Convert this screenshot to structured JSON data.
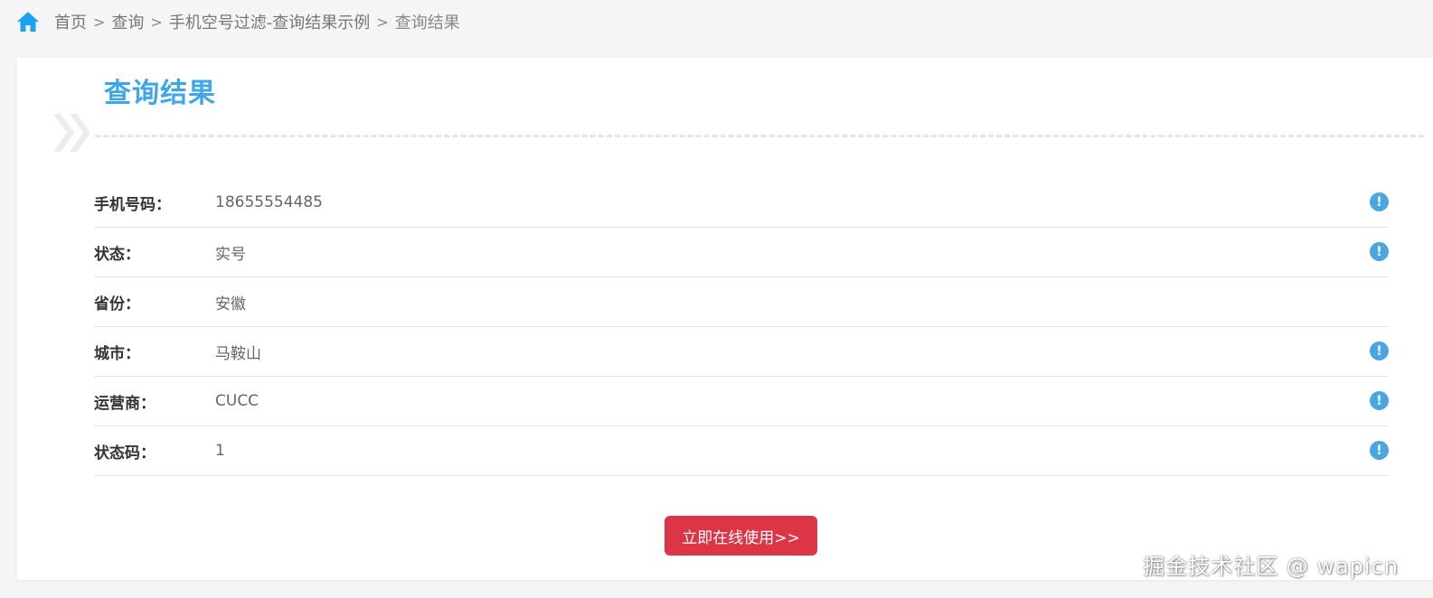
{
  "breadcrumb": {
    "items": [
      "首页",
      "查询",
      "手机空号过滤-查询结果示例",
      "查询结果"
    ],
    "separator": ">"
  },
  "result": {
    "title": "查询结果",
    "rows": [
      {
        "label": "手机号码：",
        "value": "18655554485",
        "has_info_icon": true
      },
      {
        "label": "状态：",
        "value": "实号",
        "has_info_icon": true
      },
      {
        "label": "省份：",
        "value": "安徽",
        "has_info_icon": false
      },
      {
        "label": "城市：",
        "value": "马鞍山",
        "has_info_icon": true
      },
      {
        "label": "运营商：",
        "value": "CUCC",
        "has_info_icon": true
      },
      {
        "label": "状态码：",
        "value": "1",
        "has_info_icon": true
      }
    ],
    "info_icon_glyph": "!"
  },
  "action": {
    "use_label": "立即在线使用>>"
  },
  "watermark": {
    "text": "掘金技术社区 @ wapicn"
  },
  "colors": {
    "accent": "#3fa7e6",
    "button": "#dc3545",
    "home_icon": "#1aa3f0",
    "info_icon": "#4aa6e0"
  },
  "icons": {
    "home": "home-icon",
    "chevrons": "double-chevron-right-icon",
    "info": "info-icon"
  }
}
